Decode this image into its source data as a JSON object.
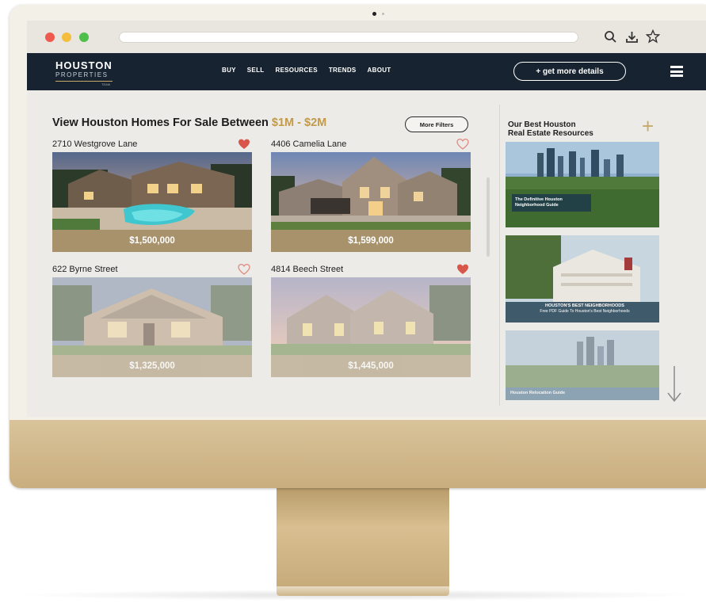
{
  "browser": {
    "icons": [
      "search-icon",
      "download-icon",
      "star-icon"
    ]
  },
  "site": {
    "logo_main": "HOUSTON",
    "logo_sub": "PROPERTIES",
    "logo_tiny": "TEAM",
    "nav": [
      "BUY",
      "SELL",
      "RESOURCES",
      "TRENDS",
      "ABOUT"
    ],
    "cta": "+ get more details"
  },
  "main": {
    "title_prefix": "View Houston Homes For Sale Between ",
    "title_range": "$1M - $2M",
    "filters_button": "More Filters",
    "listings": [
      {
        "address": "2710 Westgrove Lane",
        "price": "$1,500,000",
        "favorited": true
      },
      {
        "address": "4406 Camelia Lane",
        "price": "$1,599,000",
        "favorited": false
      },
      {
        "address": "622 Byrne Street",
        "price": "$1,325,000",
        "favorited": false
      },
      {
        "address": "4814 Beech Street",
        "price": "$1,445,000",
        "favorited": true
      }
    ]
  },
  "resources": {
    "title_line1": "Our Best Houston",
    "title_line2": "Real Estate Resources",
    "cards": [
      {
        "label_line1": "The Definitive Houston",
        "label_line2": "Neighborhood Guide"
      },
      {
        "label_line1": "HOUSTON'S BEST NEIGHBORHOODS",
        "label_line2": "Free PDF Guide To Houston's Best Neighborhoods"
      },
      {
        "label_line1": "Houston Relocation Guide",
        "label_line2": ""
      }
    ]
  },
  "colors": {
    "nav_bg": "#172331",
    "accent_gold": "#c29a48",
    "price_bar": "#a8926b",
    "heart_filled": "#d9564a",
    "heart_outline": "#e08a80"
  }
}
